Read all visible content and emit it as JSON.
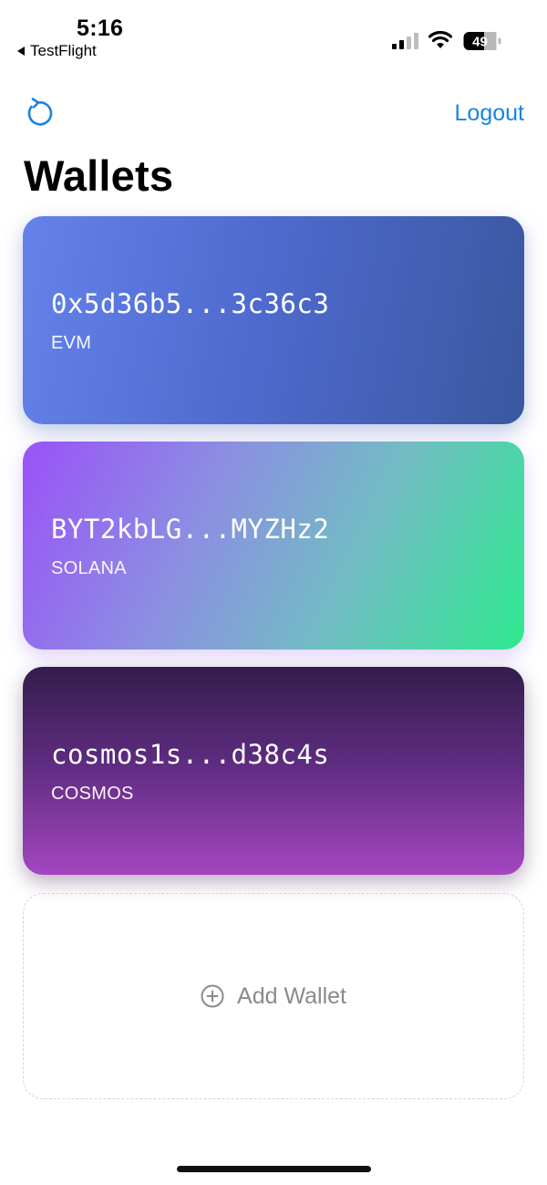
{
  "status_bar": {
    "time": "5:16",
    "back_app": "TestFlight",
    "battery_level": "49"
  },
  "nav": {
    "refresh_icon": "refresh-icon",
    "logout_label": "Logout"
  },
  "page": {
    "title": "Wallets"
  },
  "wallets": [
    {
      "address": "0x5d36b5...3c36c3",
      "chain": "EVM"
    },
    {
      "address": "BYT2kbLG...MYZHz2",
      "chain": "SOLANA"
    },
    {
      "address": "cosmos1s...d38c4s",
      "chain": "COSMOS"
    }
  ],
  "add_wallet": {
    "label": "Add Wallet",
    "icon": "plus-circle-icon"
  },
  "colors": {
    "accent": "#1a84e0",
    "muted": "#8a8a8e"
  }
}
